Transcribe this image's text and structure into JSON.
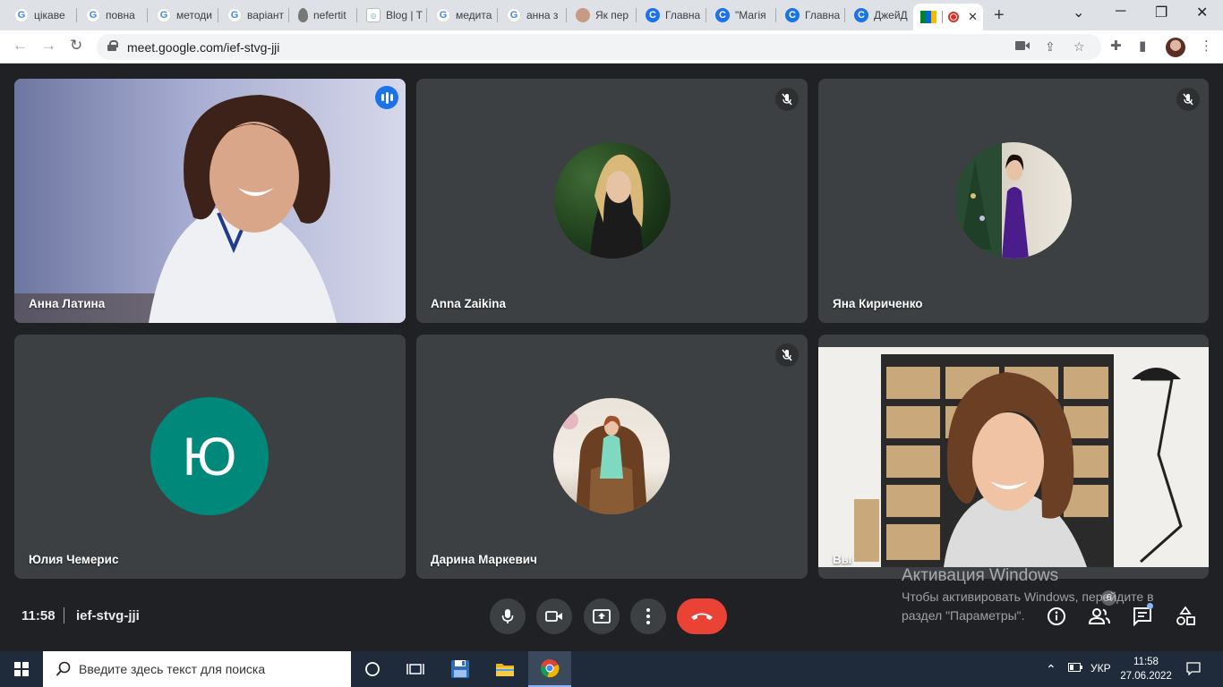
{
  "browser": {
    "tabs": [
      {
        "label": "цікаве",
        "icon": "google-icon"
      },
      {
        "label": "повна",
        "icon": "google-icon"
      },
      {
        "label": "методи",
        "icon": "google-icon"
      },
      {
        "label": "варіант",
        "icon": "google-icon"
      },
      {
        "label": "nefertit",
        "icon": "drop-icon"
      },
      {
        "label": "Blog | T",
        "icon": "blog-icon"
      },
      {
        "label": "медита",
        "icon": "google-icon"
      },
      {
        "label": "анна з",
        "icon": "google-icon"
      },
      {
        "label": "Як пер",
        "icon": "face-icon"
      },
      {
        "label": "Главна",
        "icon": "canva-icon"
      },
      {
        "label": "\"Магія",
        "icon": "canva-icon"
      },
      {
        "label": "Главна",
        "icon": "canva-icon"
      },
      {
        "label": "ДжейД",
        "icon": "canva-icon"
      }
    ],
    "url": "meet.google.com/ief-stvg-jji"
  },
  "meeting": {
    "participants": [
      {
        "name": "Анна Латина",
        "state": "speaking"
      },
      {
        "name": "Anna Zaikina",
        "state": "muted"
      },
      {
        "name": "Яна Кириченко",
        "state": "muted"
      },
      {
        "name": "Юлия Чемерис",
        "initial": "Ю"
      },
      {
        "name": "Дарина Маркевич",
        "state": "muted"
      },
      {
        "name": "Вы",
        "state": "self"
      }
    ],
    "time": "11:58",
    "code": "ief-stvg-jji",
    "people_count": "6"
  },
  "watermark": {
    "title": "Активация Windows",
    "subtitle": "Чтобы активировать Windows, перейдите в раздел \"Параметры\"."
  },
  "taskbar": {
    "search_placeholder": "Введите здесь текст для поиска",
    "language": "УКР",
    "time": "11:58",
    "date": "27.06.2022"
  },
  "colors": {
    "meet_background": "#202124",
    "tile": "#3c4043",
    "speaking_outline": "#8ab4f8",
    "end_call": "#ea4335",
    "letter_avatar": "#00897b"
  }
}
